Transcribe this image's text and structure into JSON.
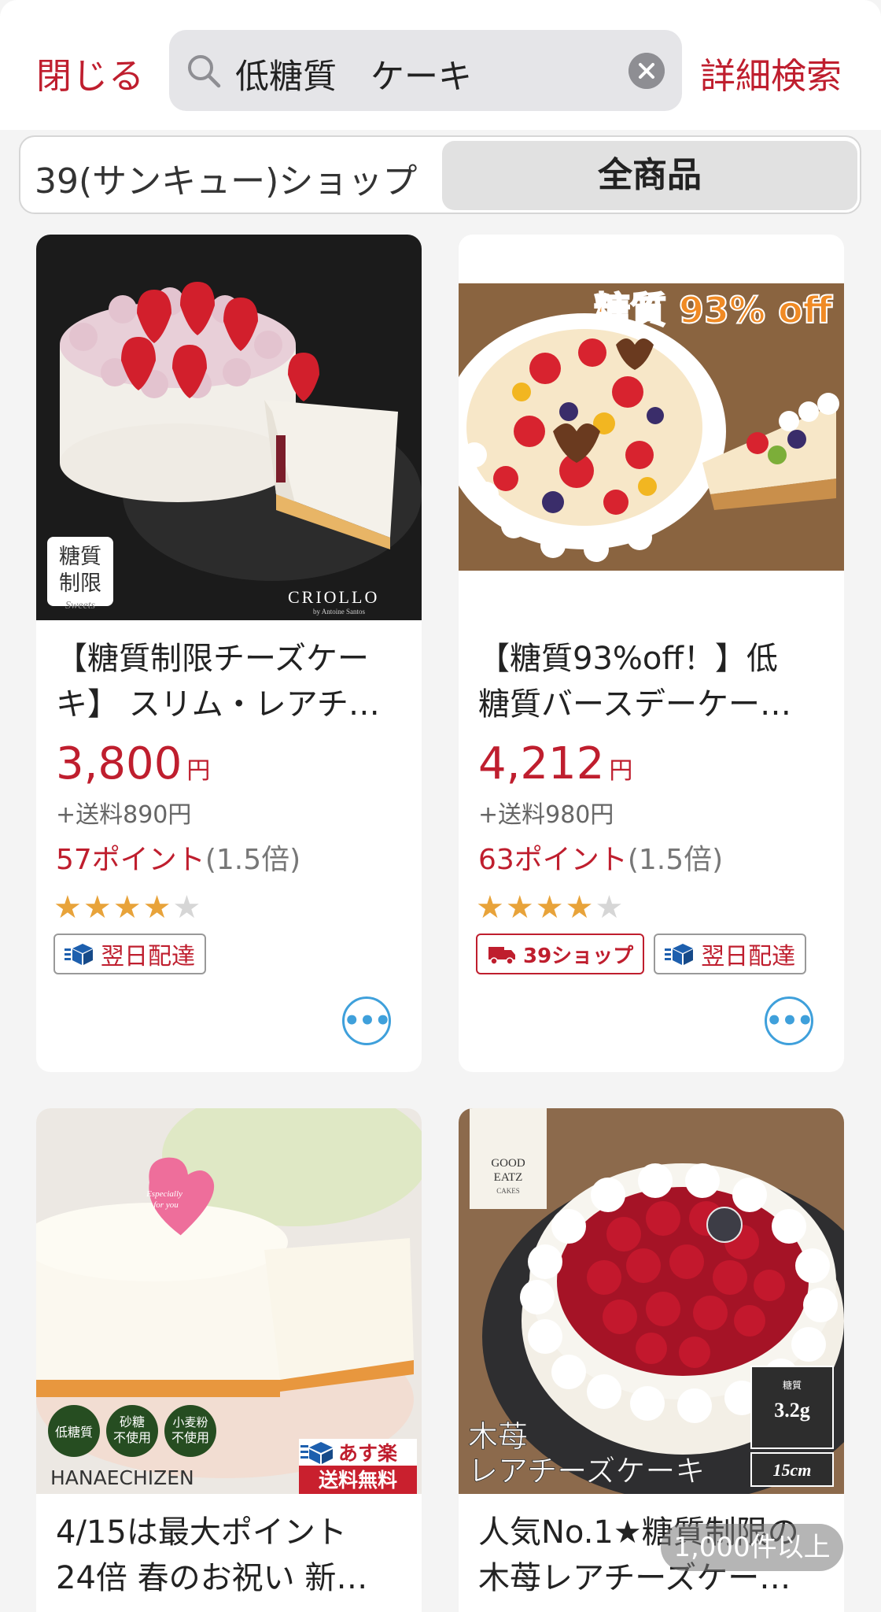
{
  "header": {
    "close_label": "閉じる",
    "search_value": "低糖質　ケーキ",
    "advanced_search_label": "詳細検索"
  },
  "segment": {
    "left_label": "39(サンキュー)ショップ",
    "right_label": "全商品",
    "selected": "全商品"
  },
  "products": [
    {
      "title_line1": "【糖質制限チーズケー",
      "title_line2": "キ】 スリム・レアチ…",
      "price": "3,800",
      "yen": "円",
      "shipping": "+送料890円",
      "points": "57ポイント",
      "multiplier": "(1.5倍)",
      "rating": 4.5,
      "badges": [
        "翌日配達"
      ],
      "image": {
        "brand": "CRIOLLO",
        "brand_sub": "by Antoine Santos",
        "stamp_line1": "糖質",
        "stamp_line2": "制限",
        "stamp_script": "Sweets"
      }
    },
    {
      "title_line1": "【糖質93%off！】低",
      "title_line2": "糖質バースデーケー…",
      "price": "4,212",
      "yen": "円",
      "shipping": "+送料980円",
      "points": "63ポイント",
      "multiplier": "(1.5倍)",
      "rating": 4.5,
      "badges": [
        "39ショップ",
        "翌日配達"
      ],
      "image": {
        "banner": "糖質 93% off"
      }
    },
    {
      "title_line1": "4/15は最大ポイント",
      "title_line2": "24倍 春のお祝い 新…",
      "image": {
        "brand": "HANAECHIZEN",
        "tag1": "低糖質",
        "tag2_line1": "砂糖",
        "tag2_line2": "不使用",
        "tag3_line1": "小麦粉",
        "tag3_line2": "不使用",
        "asuraku": "あす楽",
        "free_ship": "送料無料",
        "heart_line1": "Especially",
        "heart_line2": "for you"
      }
    },
    {
      "title_line1": "人気No.1★糖質制限の",
      "title_line2": "木苺レアチーズケー…",
      "image": {
        "brand_line1": "GOOD",
        "brand_line2": "EATZ",
        "brand_line3": "CAKES",
        "caption_line1": "木苺",
        "caption_line2": "レアチーズケーキ",
        "sugar_label": "糖質",
        "sugar_value": "3.2g",
        "size": "15cm"
      }
    }
  ],
  "result_count": "1,000件以上",
  "colors": {
    "accent": "#bf1e2e",
    "link_blue": "#3fa0db",
    "star": "#e8a33a"
  },
  "icons": [
    "search-icon",
    "clear-icon",
    "delivery-box-icon",
    "truck-icon",
    "more-icon",
    "star-icon"
  ]
}
